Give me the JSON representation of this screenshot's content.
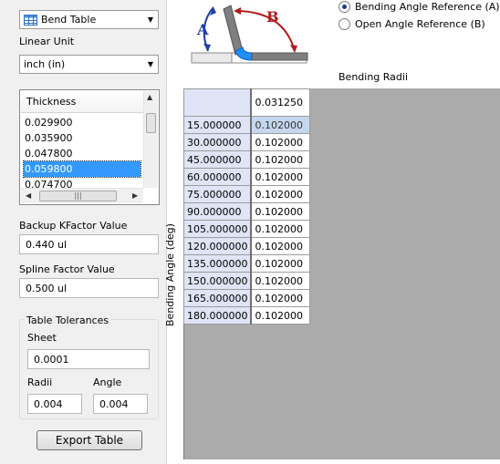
{
  "table_type": {
    "selected": "Bend Table"
  },
  "linear_unit": {
    "label": "Linear Unit",
    "selected": "inch (in)"
  },
  "thickness_list": {
    "header": "Thickness",
    "items": [
      "0.029900",
      "0.035900",
      "0.047800",
      "0.059800",
      "0.074700"
    ],
    "selected_index": 3
  },
  "backup_kfactor": {
    "label": "Backup KFactor Value",
    "value": "0.440 ul"
  },
  "spline_factor": {
    "label": "Spline Factor Value",
    "value": "0.500 ul"
  },
  "table_tolerances": {
    "title": "Table Tolerances",
    "sheet_label": "Sheet",
    "sheet_value": "0.0001",
    "radii_label": "Radii",
    "radii_value": "0.004",
    "angle_label": "Angle",
    "angle_value": "0.004"
  },
  "export_button": "Export Table",
  "diagram": {
    "label_a": "A",
    "label_b": "B"
  },
  "angle_reference": {
    "options": [
      "Bending Angle Reference (A)",
      "Open Angle Reference (B)"
    ],
    "selected_index": 0
  },
  "grid": {
    "column_axis_label": "Bending Radii",
    "row_axis_label": "Bending Angle (deg)",
    "columns": [
      "0.031250"
    ],
    "rows": [
      {
        "angle": "15.000000",
        "values": [
          "0.102000"
        ]
      },
      {
        "angle": "30.000000",
        "values": [
          "0.102000"
        ]
      },
      {
        "angle": "45.000000",
        "values": [
          "0.102000"
        ]
      },
      {
        "angle": "60.000000",
        "values": [
          "0.102000"
        ]
      },
      {
        "angle": "75.000000",
        "values": [
          "0.102000"
        ]
      },
      {
        "angle": "90.000000",
        "values": [
          "0.102000"
        ]
      },
      {
        "angle": "105.000000",
        "values": [
          "0.102000"
        ]
      },
      {
        "angle": "120.000000",
        "values": [
          "0.102000"
        ]
      },
      {
        "angle": "135.000000",
        "values": [
          "0.102000"
        ]
      },
      {
        "angle": "150.000000",
        "values": [
          "0.102000"
        ]
      },
      {
        "angle": "165.000000",
        "values": [
          "0.102000"
        ]
      },
      {
        "angle": "180.000000",
        "values": [
          "0.102000"
        ]
      }
    ]
  },
  "colors": {
    "selection": "#3399ff",
    "row_header": "#dfe4f6",
    "grid_background": "#ababab",
    "arrow_blue": "#1f3fa8",
    "arrow_red": "#b01c1c",
    "bend_blue": "#1e90ff"
  }
}
